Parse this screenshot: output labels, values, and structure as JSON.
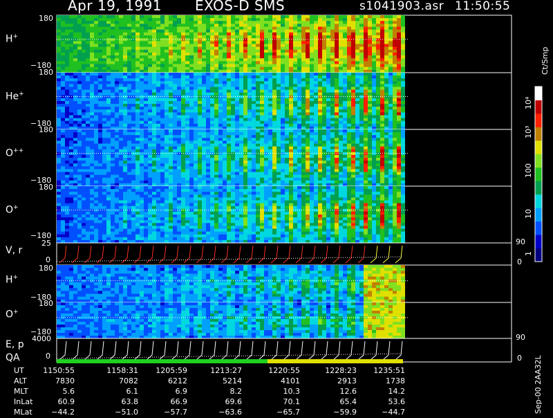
{
  "header": {
    "date": "Apr 19, 1991",
    "instrument": "EXOS-D SMS",
    "file": "s1041903.asr",
    "time": "11:50:55"
  },
  "panels": [
    {
      "label": "H",
      "sup": "+",
      "top": "180",
      "bottom": "−180"
    },
    {
      "label": "He",
      "sup": "+",
      "top": "180",
      "bottom": "−180"
    },
    {
      "label": "O",
      "sup": "++",
      "top": "180",
      "bottom": "−180"
    },
    {
      "label": "O",
      "sup": "+",
      "top": "180",
      "bottom": "−180"
    },
    {
      "label": "V, r",
      "sup": "",
      "top": "25",
      "bottom": "0",
      "right_top": "90",
      "right_bottom": "0"
    },
    {
      "label": "H",
      "sup": "+",
      "top": "180",
      "bottom": "−180"
    },
    {
      "label": "O",
      "sup": "+",
      "top": "180",
      "bottom": "−180"
    },
    {
      "label": "E, p",
      "sup": "",
      "label2": "QA",
      "top": "4000",
      "bottom": "0",
      "right_top": "90",
      "right_bottom": "0"
    }
  ],
  "colorbar": {
    "unit": "Ct/Smp",
    "ticks": [
      "10⁴",
      "10³",
      "100",
      "10",
      "1"
    ]
  },
  "footer_id": "Sep-00  2AA32L",
  "table": {
    "rows": [
      {
        "label": "UT",
        "values": [
          "1150:55",
          "1158:31",
          "1205:59",
          "1213:27",
          "1220:55",
          "1228:23",
          "1235:51"
        ]
      },
      {
        "label": "ALT",
        "values": [
          "7830",
          "7082",
          "6212",
          "5214",
          "4101",
          "2913",
          "1738"
        ]
      },
      {
        "label": "MLT",
        "values": [
          "5.6",
          "6.1",
          "6.9",
          "8.2",
          "10.3",
          "12.6",
          "14.2"
        ]
      },
      {
        "label": "InLat",
        "values": [
          "60.9",
          "63.8",
          "66.9",
          "69.6",
          "70.1",
          "65.4",
          "53.6"
        ]
      },
      {
        "label": "MLat",
        "values": [
          "−44.2",
          "−51.0",
          "−57.7",
          "−63.6",
          "−65.7",
          "−59.9",
          "−44.7"
        ]
      }
    ]
  },
  "chart_data": {
    "type": "heatmap",
    "title": "Apr 19, 1991   EXOS-D SMS   s1041903.asr  11:50:55",
    "x": [
      "1150:55",
      "1158:31",
      "1205:59",
      "1213:27",
      "1220:55",
      "1228:23",
      "1235:51"
    ],
    "x_range": [
      "1150:55",
      "1238:30"
    ],
    "colorscale_unit": "Ct/Smp",
    "colorscale_range": [
      1,
      10000
    ],
    "colorscale": "log",
    "colors": [
      "#000080",
      "#0000c8",
      "#0050ff",
      "#00a0ff",
      "#00d8e0",
      "#00a050",
      "#20c020",
      "#80e020",
      "#e0e000",
      "#c08000",
      "#ff2000",
      "#c00000",
      "#ffffff"
    ],
    "panels": [
      {
        "species": "H+",
        "ylim": [
          -180,
          180
        ]
      },
      {
        "species": "He+",
        "ylim": [
          -180,
          180
        ]
      },
      {
        "species": "O++",
        "ylim": [
          -180,
          180
        ]
      },
      {
        "species": "O+",
        "ylim": [
          -180,
          180
        ]
      },
      {
        "species": "V, r",
        "ylim": [
          0,
          25
        ],
        "y2lim": [
          0,
          90
        ]
      },
      {
        "species": "H+",
        "ylim": [
          -180,
          180
        ]
      },
      {
        "species": "O+",
        "ylim": [
          -180,
          180
        ]
      },
      {
        "species": "E, p / QA",
        "ylim": [
          0,
          4000
        ],
        "y2lim": [
          0,
          90
        ]
      }
    ],
    "qa_bar": [
      "green",
      "yellow"
    ]
  }
}
